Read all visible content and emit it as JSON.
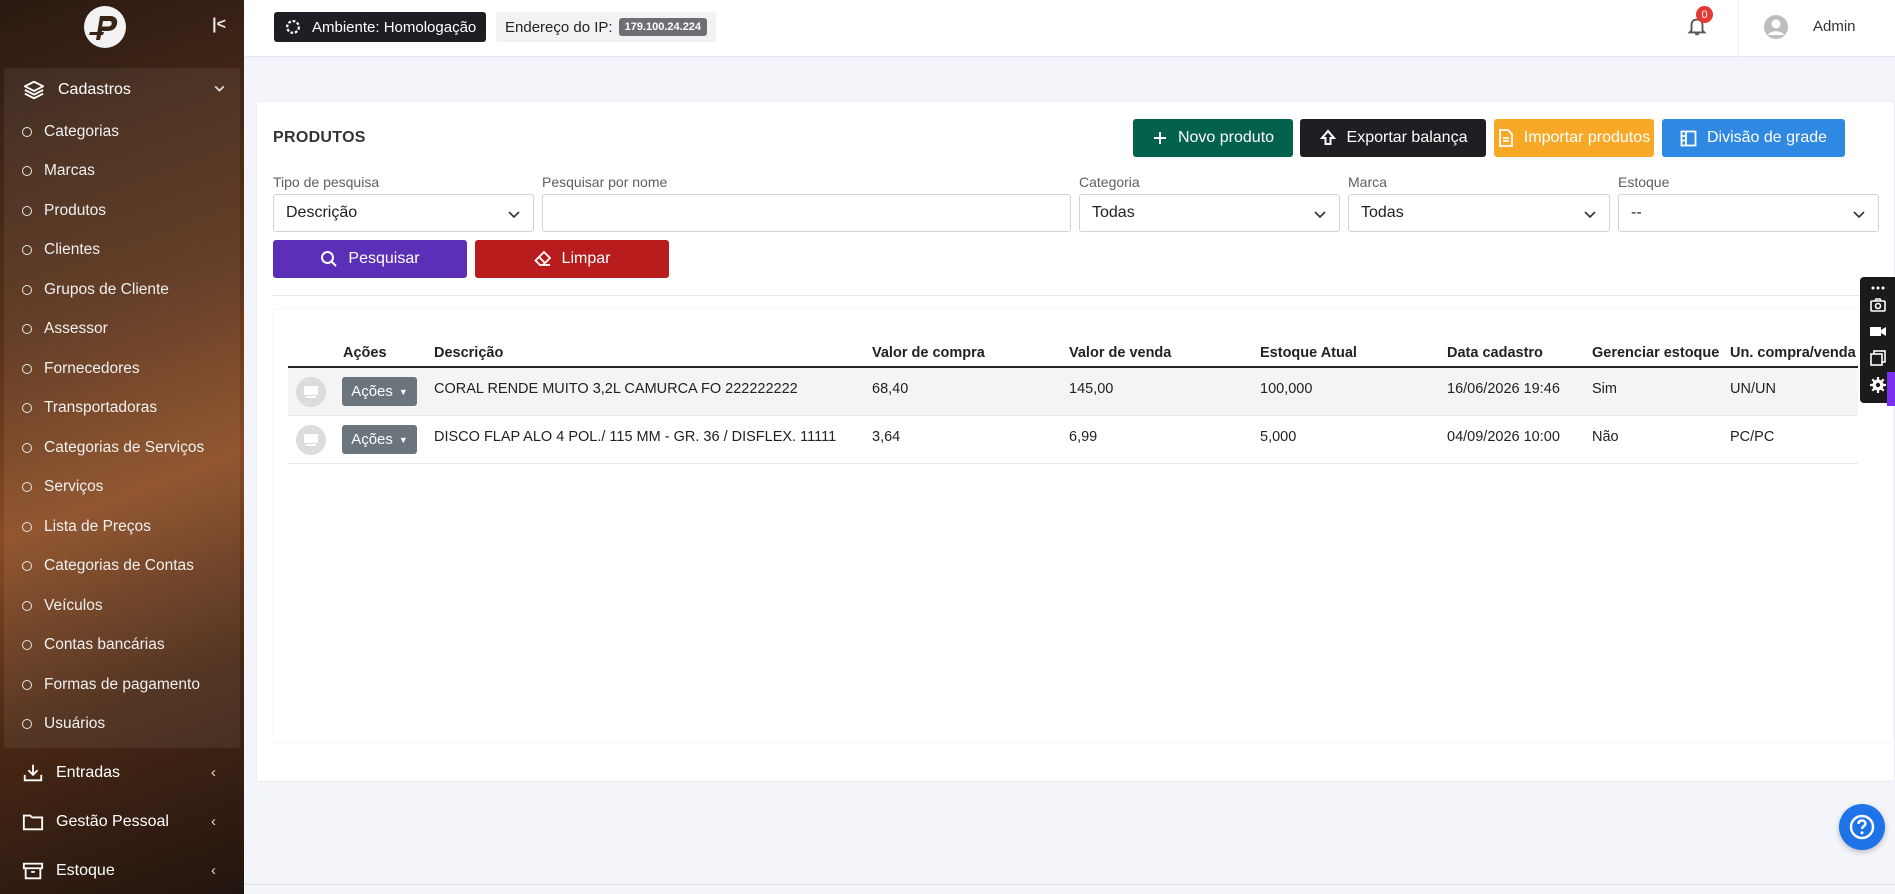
{
  "sidebar": {
    "open_group": {
      "label": "Cadastros",
      "icon": "layers-icon"
    },
    "items": [
      {
        "label": "Categorias"
      },
      {
        "label": "Marcas"
      },
      {
        "label": "Produtos"
      },
      {
        "label": "Clientes"
      },
      {
        "label": "Grupos de Cliente"
      },
      {
        "label": "Assessor"
      },
      {
        "label": "Fornecedores"
      },
      {
        "label": "Transportadoras"
      },
      {
        "label": "Categorias de Serviços"
      },
      {
        "label": "Serviços"
      },
      {
        "label": "Lista de Preços"
      },
      {
        "label": "Categorias de Contas"
      },
      {
        "label": "Veículos"
      },
      {
        "label": "Contas bancárias"
      },
      {
        "label": "Formas de pagamento"
      },
      {
        "label": "Usuários"
      }
    ],
    "closed_groups": [
      {
        "label": "Entradas",
        "icon": "download-tray-icon"
      },
      {
        "label": "Gestão Pessoal",
        "icon": "folder-icon"
      },
      {
        "label": "Estoque",
        "icon": "archive-box-icon"
      }
    ]
  },
  "topbar": {
    "environment": "Ambiente: Homologação",
    "ip_label": "Endereço do IP:",
    "ip_value": "179.100.24.224",
    "notifications_count": "0",
    "user_name": "Admin"
  },
  "page": {
    "title": "PRODUTOS",
    "buttons": {
      "novo": "Novo produto",
      "exportar": "Exportar balança",
      "importar": "Importar produtos",
      "divisao": "Divisão de grade",
      "pesquisar": "Pesquisar",
      "limpar": "Limpar"
    },
    "filters": {
      "tipo_label": "Tipo de pesquisa",
      "tipo_value": "Descrição",
      "nome_label": "Pesquisar por nome",
      "nome_value": "",
      "categoria_label": "Categoria",
      "categoria_value": "Todas",
      "marca_label": "Marca",
      "marca_value": "Todas",
      "estoque_label": "Estoque",
      "estoque_value": "--"
    }
  },
  "table": {
    "headers": [
      "Ações",
      "Descrição",
      "Valor de compra",
      "Valor de venda",
      "Estoque Atual",
      "Data cadastro",
      "Gerenciar estoque",
      "Un. compra/venda"
    ],
    "action_label": "Ações",
    "rows": [
      {
        "descricao": "CORAL RENDE MUITO 3,2L CAMURCA FO 222222222",
        "valor_compra": "68,40",
        "valor_venda": "145,00",
        "estoque": "100,000",
        "data": "16/06/2026 19:46",
        "gerenciar": "Sim",
        "unidade": "UN/UN"
      },
      {
        "descricao": "DISCO FLAP ALO 4 POL./ 115 MM - GR. 36 / DISFLEX. 11111",
        "valor_compra": "3,64",
        "valor_venda": "6,99",
        "estoque": "5,000",
        "data": "04/09/2026 10:00",
        "gerenciar": "Não",
        "unidade": "PC/PC"
      }
    ]
  },
  "colors": {
    "novo": "#04614c",
    "exportar": "#1e1f23",
    "importar": "#f7a826",
    "divisao": "#2f88e2",
    "pesquisar": "#5b2fb8",
    "limpar": "#b81c1c"
  }
}
